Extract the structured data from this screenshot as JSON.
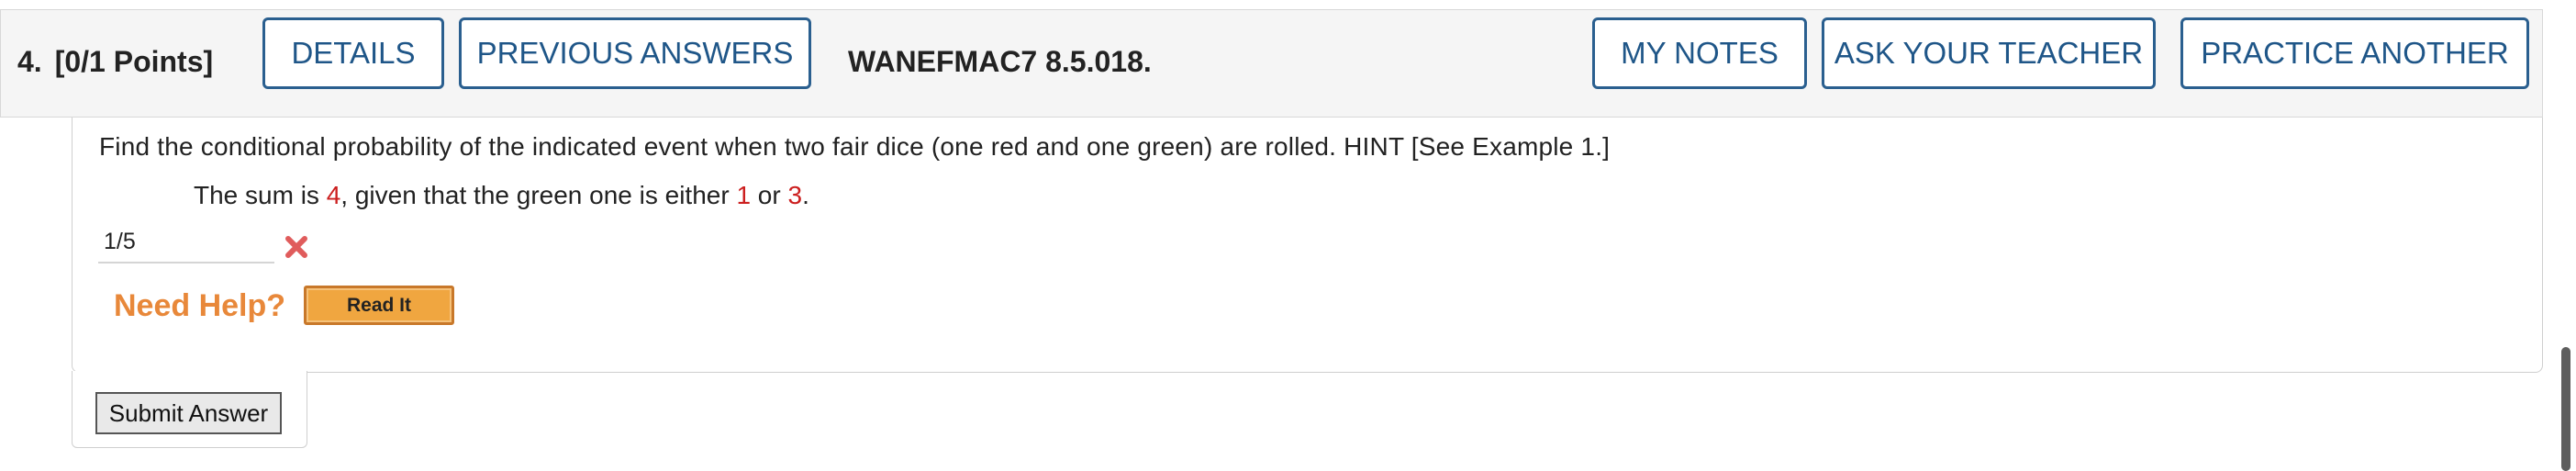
{
  "header": {
    "question_number": "4.",
    "points": "[0/1 Points]",
    "details_label": "DETAILS",
    "previous_answers_label": "PREVIOUS ANSWERS",
    "question_code": "WANEFMAC7 8.5.018.",
    "my_notes_label": "MY NOTES",
    "ask_teacher_label": "ASK YOUR TEACHER",
    "practice_another_label": "PRACTICE ANOTHER"
  },
  "question": {
    "text": "Find the conditional probability of the indicated event when two fair dice (one red and one green) are rolled. HINT [See Example 1.]",
    "sub_part1": "The sum is ",
    "sum_value": "4",
    "sub_part2": ", given that the green one is either ",
    "green_value1": "1",
    "sub_part3": " or ",
    "green_value2": "3",
    "sub_part4": "."
  },
  "answer": {
    "value": "1/5",
    "status_icon": "wrong-x-icon"
  },
  "help": {
    "label": "Need Help?",
    "read_it_label": "Read It"
  },
  "submit": {
    "label": "Submit Answer"
  },
  "colors": {
    "accent": "#1f5688",
    "highlight_red": "#cc1f1f",
    "help_orange": "#e8883a",
    "wrong_icon": "#e05c5c"
  }
}
